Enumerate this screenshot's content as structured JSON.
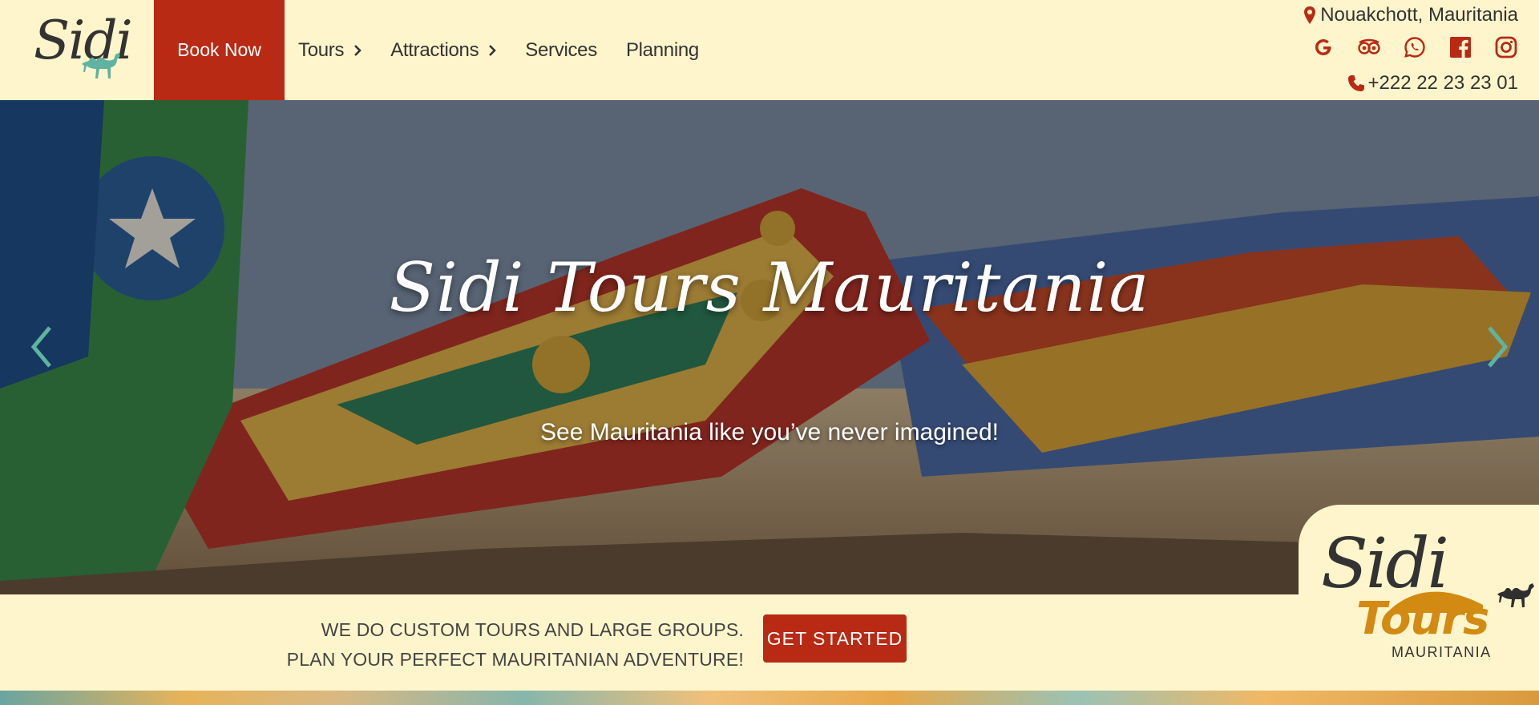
{
  "header": {
    "logo_text": "Sidi",
    "book_now_label": "Book Now",
    "nav": [
      {
        "label": "Tours",
        "has_dropdown": true
      },
      {
        "label": "Attractions",
        "has_dropdown": true
      },
      {
        "label": "Services",
        "has_dropdown": false
      },
      {
        "label": "Planning",
        "has_dropdown": false
      }
    ],
    "location": "Nouakchott, Mauritania",
    "phone": "+222 22 23 23 01",
    "socials": [
      "google-icon",
      "tripadvisor-icon",
      "whatsapp-icon",
      "facebook-icon",
      "instagram-icon"
    ]
  },
  "hero": {
    "title": "Sidi Tours Mauritania",
    "subtitle": "See Mauritania like you’ve never imagined!"
  },
  "cta": {
    "line1": "We do custom tours and large groups.",
    "line2": "Plan your perfect Mauritanian adventure!",
    "button_label": "Get Started"
  },
  "badge": {
    "sidi": "Sidi",
    "tours": "Tours",
    "country": "MAURITANIA"
  },
  "colors": {
    "accent_red": "#b92a14",
    "cream": "#fff5cc",
    "teal": "#5fb3a0",
    "gold": "#d38a12"
  }
}
